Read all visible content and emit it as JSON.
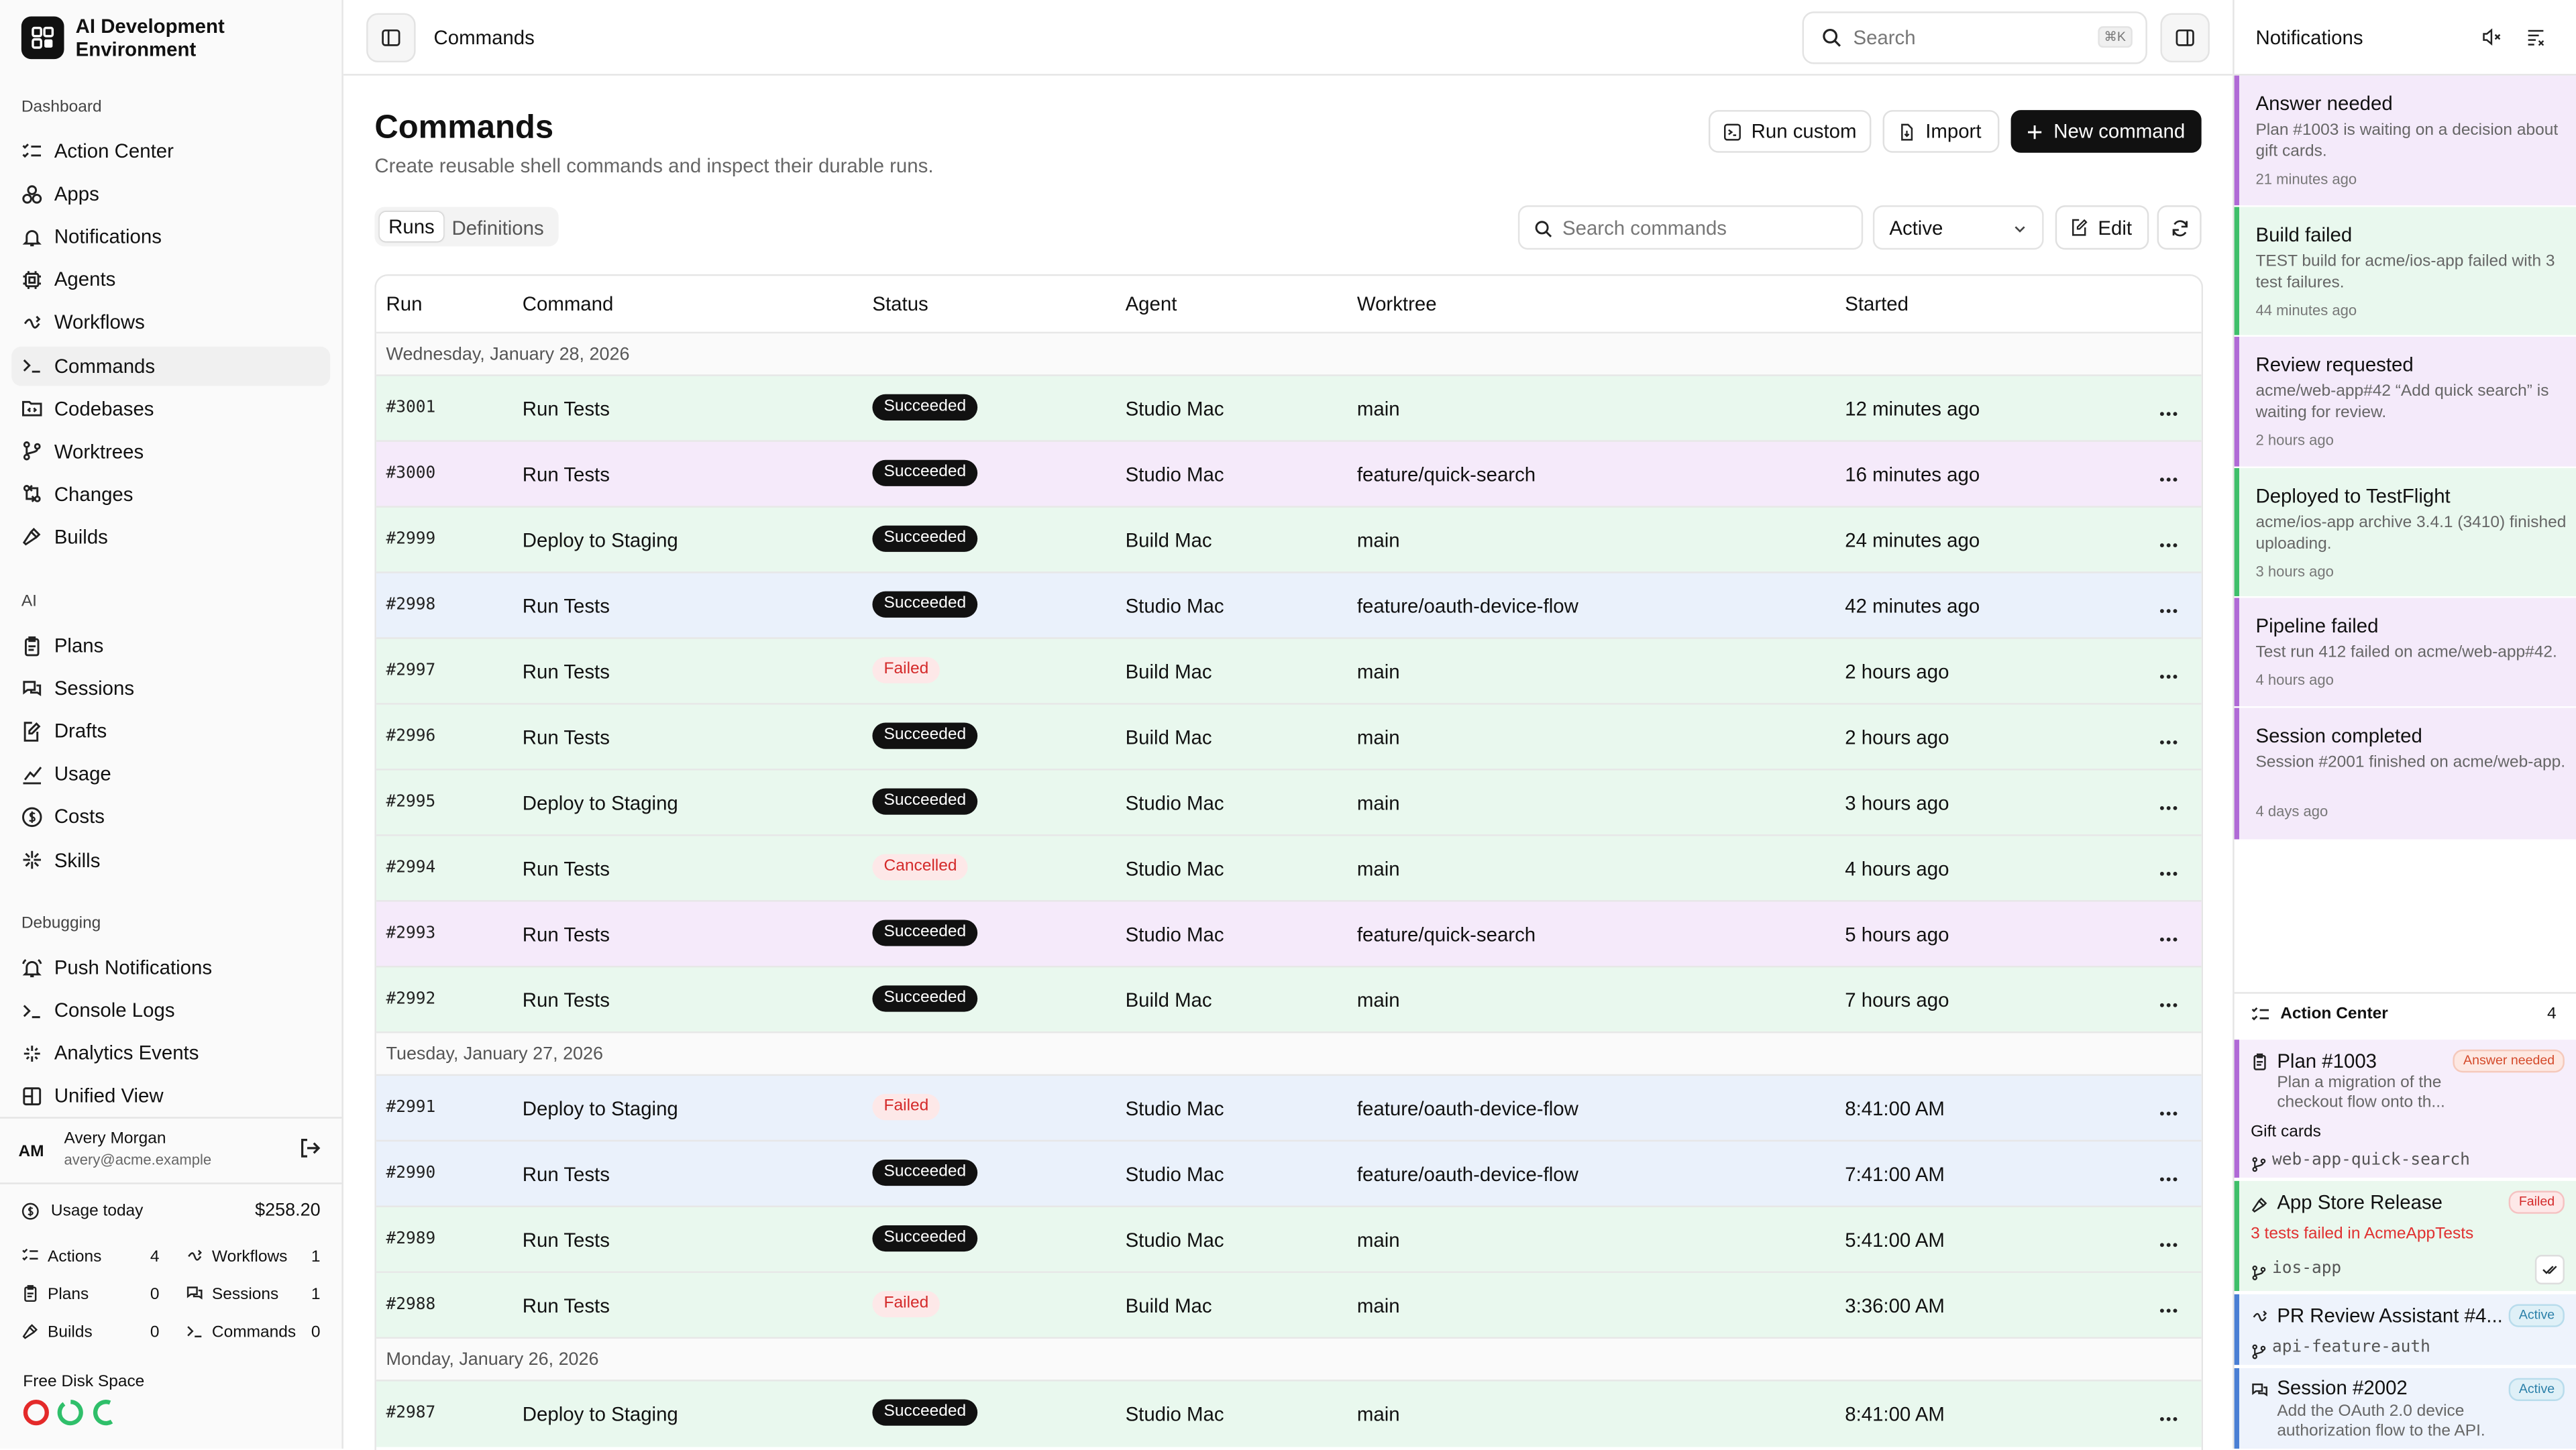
{
  "app": {
    "title_line1": "AI Development",
    "title_line2": "Environment"
  },
  "sidebar": {
    "sections": [
      {
        "heading": "Dashboard",
        "items": [
          {
            "label": "Action Center",
            "icon": "list-checks-icon"
          },
          {
            "label": "Apps",
            "icon": "boxes-icon"
          },
          {
            "label": "Notifications",
            "icon": "bell-icon"
          },
          {
            "label": "Agents",
            "icon": "cpu-icon"
          },
          {
            "label": "Workflows",
            "icon": "workflow-icon"
          },
          {
            "label": "Commands",
            "icon": "terminal-icon",
            "active": true
          },
          {
            "label": "Codebases",
            "icon": "folder-code-icon"
          },
          {
            "label": "Worktrees",
            "icon": "git-branch-icon"
          },
          {
            "label": "Changes",
            "icon": "git-compare-icon"
          },
          {
            "label": "Builds",
            "icon": "hammer-icon"
          }
        ]
      },
      {
        "heading": "AI",
        "items": [
          {
            "label": "Plans",
            "icon": "clipboard-icon"
          },
          {
            "label": "Sessions",
            "icon": "chat-icon"
          },
          {
            "label": "Drafts",
            "icon": "file-edit-icon"
          },
          {
            "label": "Usage",
            "icon": "chart-icon"
          },
          {
            "label": "Costs",
            "icon": "dollar-icon"
          },
          {
            "label": "Skills",
            "icon": "sparkles-icon"
          }
        ]
      },
      {
        "heading": "Debugging",
        "items": [
          {
            "label": "Push Notifications",
            "icon": "bell-ring-icon"
          },
          {
            "label": "Console Logs",
            "icon": "terminal-icon"
          },
          {
            "label": "Analytics Events",
            "icon": "spark-icon"
          },
          {
            "label": "Unified View",
            "icon": "layout-icon"
          }
        ]
      }
    ],
    "user": {
      "initials": "AM",
      "name": "Avery Morgan",
      "email": "avery@acme.example"
    },
    "usage": {
      "label": "Usage today",
      "amount": "$258.20",
      "stats": [
        {
          "label": "Actions",
          "value": "4"
        },
        {
          "label": "Workflows",
          "value": "1"
        },
        {
          "label": "Plans",
          "value": "0"
        },
        {
          "label": "Sessions",
          "value": "1"
        },
        {
          "label": "Builds",
          "value": "0"
        },
        {
          "label": "Commands",
          "value": "0"
        }
      ]
    },
    "disk": {
      "label": "Free Disk Space"
    }
  },
  "header": {
    "breadcrumb": "Commands",
    "search_placeholder": "Search",
    "search_shortcut": "⌘K"
  },
  "page": {
    "title": "Commands",
    "subtitle": "Create reusable shell commands and inspect their durable runs.",
    "actions": {
      "run_custom": "Run custom",
      "import": "Import",
      "new_command": "New command"
    },
    "tabs": [
      {
        "label": "Runs",
        "active": true
      },
      {
        "label": "Definitions"
      }
    ],
    "filter": {
      "search_placeholder": "Search commands",
      "status_value": "Active",
      "edit_label": "Edit"
    }
  },
  "table": {
    "columns": [
      "Run",
      "Command",
      "Status",
      "Agent",
      "Worktree",
      "Started"
    ],
    "groups": [
      {
        "date": "Wednesday, January 28, 2026",
        "rows": [
          {
            "run": "#3001",
            "command": "Run Tests",
            "status": "Succeeded",
            "agent": "Studio Mac",
            "worktree": "main",
            "started": "12 minutes ago",
            "tint": "#e9f8ee"
          },
          {
            "run": "#3000",
            "command": "Run Tests",
            "status": "Succeeded",
            "agent": "Studio Mac",
            "worktree": "feature/quick-search",
            "started": "16 minutes ago",
            "tint": "#f5eafa"
          },
          {
            "run": "#2999",
            "command": "Deploy to Staging",
            "status": "Succeeded",
            "agent": "Build Mac",
            "worktree": "main",
            "started": "24 minutes ago",
            "tint": "#e9f8ee"
          },
          {
            "run": "#2998",
            "command": "Run Tests",
            "status": "Succeeded",
            "agent": "Studio Mac",
            "worktree": "feature/oauth-device-flow",
            "started": "42 minutes ago",
            "tint": "#eaf1fb"
          },
          {
            "run": "#2997",
            "command": "Run Tests",
            "status": "Failed",
            "agent": "Build Mac",
            "worktree": "main",
            "started": "2 hours ago",
            "tint": "#e9f8ee"
          },
          {
            "run": "#2996",
            "command": "Run Tests",
            "status": "Succeeded",
            "agent": "Build Mac",
            "worktree": "main",
            "started": "2 hours ago",
            "tint": "#e9f8ee"
          },
          {
            "run": "#2995",
            "command": "Deploy to Staging",
            "status": "Succeeded",
            "agent": "Studio Mac",
            "worktree": "main",
            "started": "3 hours ago",
            "tint": "#e9f8ee"
          },
          {
            "run": "#2994",
            "command": "Run Tests",
            "status": "Cancelled",
            "agent": "Studio Mac",
            "worktree": "main",
            "started": "4 hours ago",
            "tint": "#e9f8ee"
          },
          {
            "run": "#2993",
            "command": "Run Tests",
            "status": "Succeeded",
            "agent": "Studio Mac",
            "worktree": "feature/quick-search",
            "started": "5 hours ago",
            "tint": "#f5eafa"
          },
          {
            "run": "#2992",
            "command": "Run Tests",
            "status": "Succeeded",
            "agent": "Build Mac",
            "worktree": "main",
            "started": "7 hours ago",
            "tint": "#e9f8ee"
          }
        ]
      },
      {
        "date": "Tuesday, January 27, 2026",
        "rows": [
          {
            "run": "#2991",
            "command": "Deploy to Staging",
            "status": "Failed",
            "agent": "Studio Mac",
            "worktree": "feature/oauth-device-flow",
            "started": "8:41:00 AM",
            "tint": "#eaf1fb"
          },
          {
            "run": "#2990",
            "command": "Run Tests",
            "status": "Succeeded",
            "agent": "Studio Mac",
            "worktree": "feature/oauth-device-flow",
            "started": "7:41:00 AM",
            "tint": "#eaf1fb"
          },
          {
            "run": "#2989",
            "command": "Run Tests",
            "status": "Succeeded",
            "agent": "Studio Mac",
            "worktree": "main",
            "started": "5:41:00 AM",
            "tint": "#e9f8ee"
          },
          {
            "run": "#2988",
            "command": "Run Tests",
            "status": "Failed",
            "agent": "Build Mac",
            "worktree": "main",
            "started": "3:36:00 AM",
            "tint": "#e9f8ee"
          }
        ]
      },
      {
        "date": "Monday, January 26, 2026",
        "rows": [
          {
            "run": "#2987",
            "command": "Deploy to Staging",
            "status": "Succeeded",
            "agent": "Studio Mac",
            "worktree": "main",
            "started": "8:41:00 AM",
            "tint": "#e9f8ee"
          }
        ]
      }
    ]
  },
  "notifications": {
    "title": "Notifications",
    "items": [
      {
        "title": "Answer needed",
        "desc": "Plan #1003 is waiting on a decision about gift cards.",
        "when": "21 minutes ago",
        "bar": "#b06ad6",
        "bg": "#f4eafa"
      },
      {
        "title": "Build failed",
        "desc": "TEST build for acme/ios-app failed with 3 test failures.",
        "when": "44 minutes ago",
        "bar": "#3fbf6a",
        "bg": "#e9f8ee"
      },
      {
        "title": "Review requested",
        "desc": "acme/web-app#42 “Add quick search” is waiting for review.",
        "when": "2 hours ago",
        "bar": "#b06ad6",
        "bg": "#f4eafa"
      },
      {
        "title": "Deployed to TestFlight",
        "desc": "acme/ios-app archive 3.4.1 (3410) finished uploading.",
        "when": "3 hours ago",
        "bar": "#3fbf6a",
        "bg": "#e9f8ee"
      },
      {
        "title": "Pipeline failed",
        "desc": "Test run 412 failed on acme/web-app#42.",
        "when": "4 hours ago",
        "bar": "#b06ad6",
        "bg": "#f4eafa"
      },
      {
        "title": "Session completed",
        "desc": "Session #2001 finished on acme/web-app.",
        "when": "4 days ago",
        "bar": "#b06ad6",
        "bg": "#f4eafa"
      }
    ]
  },
  "action_center": {
    "title": "Action Center",
    "count": "4",
    "items": [
      {
        "title": "Plan #1003",
        "badge": "Answer needed",
        "desc": "Plan a migration of the checkout flow onto th...",
        "extra": "Gift cards",
        "branch": "web-app-quick-search"
      },
      {
        "title": "App Store Release",
        "badge": "Failed",
        "desc": "3 tests failed in AcmeAppTests",
        "branch": "ios-app"
      },
      {
        "title": "PR Review Assistant #4...",
        "badge": "Active",
        "branch": "api-feature-auth"
      },
      {
        "title": "Session #2002",
        "badge": "Active",
        "desc": "Add the OAuth 2.0 device authorization flow to the API."
      }
    ]
  },
  "colors": {
    "succeeded": "#111111",
    "failed": "#d42a2a",
    "accent_green": "#3fbf6a",
    "accent_purple": "#b06ad6",
    "accent_blue": "#4a7fd4"
  }
}
